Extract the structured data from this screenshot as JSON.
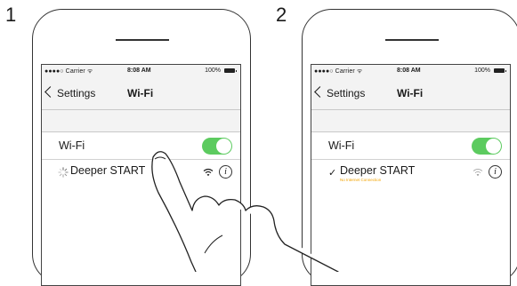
{
  "steps": [
    {
      "number": "1",
      "status_bar": {
        "carrier": "●●●●○ Carrier ᯤ",
        "time": "8:08 AM",
        "battery": "100%"
      },
      "nav": {
        "back_label": "Settings",
        "title": "Wi-Fi"
      },
      "wifi_row": {
        "label": "Wi-Fi",
        "toggle_on": true
      },
      "network": {
        "name": "Deeper START",
        "state": "connecting",
        "subtext": ""
      }
    },
    {
      "number": "2",
      "status_bar": {
        "carrier": "●●●●○ Carrier ᯤ",
        "time": "8:08 AM",
        "battery": "100%"
      },
      "nav": {
        "back_label": "Settings",
        "title": "Wi-Fi"
      },
      "wifi_row": {
        "label": "Wi-Fi",
        "toggle_on": true
      },
      "network": {
        "name": "Deeper START",
        "state": "connected",
        "subtext": "No Internet Connection",
        "check": "✓"
      }
    }
  ],
  "icons": [
    "chevron-left-icon",
    "wifi-icon",
    "info-icon",
    "spinner-icon",
    "checkmark-icon",
    "battery-icon",
    "hand-pointer-icon"
  ],
  "colors": {
    "toggle_on": "#5ccb5f",
    "warning_text": "#f2a300",
    "bar_bg": "#f3f3f3"
  }
}
